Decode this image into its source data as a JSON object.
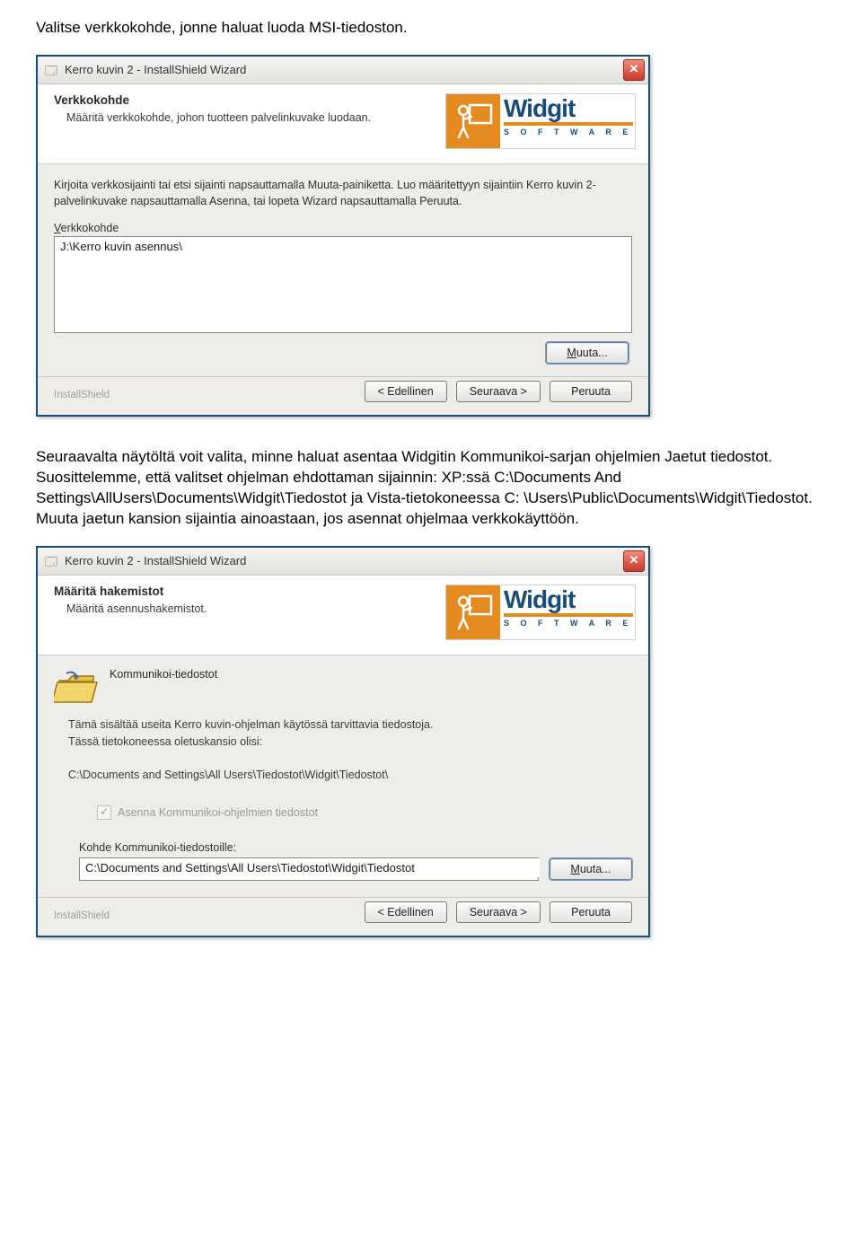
{
  "intro_1": "Valitse verkkokohde, jonne haluat luoda MSI-tiedoston.",
  "intro_2": "Seuraavalta näytöltä voit valita, minne haluat asentaa Widgitin Kommunikoi-sarjan ohjelmien Jaetut tiedostot. Suosittelemme, että valitset ohjelman ehdottaman sijainnin: XP:ssä C:\\Documents And Settings\\AllUsers\\Documents\\Widgit\\Tiedostot ja Vista-tietokoneessa C: \\Users\\Public\\Documents\\Widgit\\Tiedostot. Muuta jaetun kansion sijaintia ainoastaan, jos asennat ohjelmaa verkkokäyttöön.",
  "logo": {
    "name": "Widgit",
    "sub": "S O F T W A R E"
  },
  "common": {
    "window_title": "Kerro kuvin 2 - InstallShield Wizard",
    "installshield": "InstallShield",
    "btn_back": "< Edellinen",
    "btn_next": "Seuraava >",
    "btn_cancel": "Peruuta",
    "btn_change": "Muuta..."
  },
  "dialog1": {
    "title": "Verkkokohde",
    "subtitle": "Määritä verkkokohde, johon tuotteen palvelinkuvake luodaan.",
    "instructions": "Kirjoita verkkosijainti tai etsi sijainti napsauttamalla Muuta-painiketta. Luo määritettyyn sijaintiin Kerro kuvin 2-palvelinkuvake napsauttamalla Asenna, tai lopeta Wizard napsauttamalla Peruuta.",
    "field_label_pre": "V",
    "field_label_rest": "erkkokohde",
    "path_value": "J:\\Kerro kuvin asennus\\"
  },
  "dialog2": {
    "title": "Määritä hakemistot",
    "subtitle": "Määritä asennushakemistot.",
    "folder_title": "Kommunikoi-tiedostot",
    "desc1": "Tämä sisältää useita Kerro kuvin-ohjelman käytössä tarvittavia tiedostoja.",
    "desc2": "Tässä tietokoneessa oletuskansio olisi:",
    "default_path": "C:\\Documents and Settings\\All Users\\Tiedostot\\Widgit\\Tiedostot\\",
    "checkbox_label": "Asenna Kommunikoi-ohjelmien tiedostot",
    "target_label": "Kohde Kommunikoi-tiedostoille:",
    "target_value": "C:\\Documents and Settings\\All Users\\Tiedostot\\Widgit\\Tiedostot",
    "change_label_pre": "M",
    "change_label_rest": "uuta..."
  }
}
